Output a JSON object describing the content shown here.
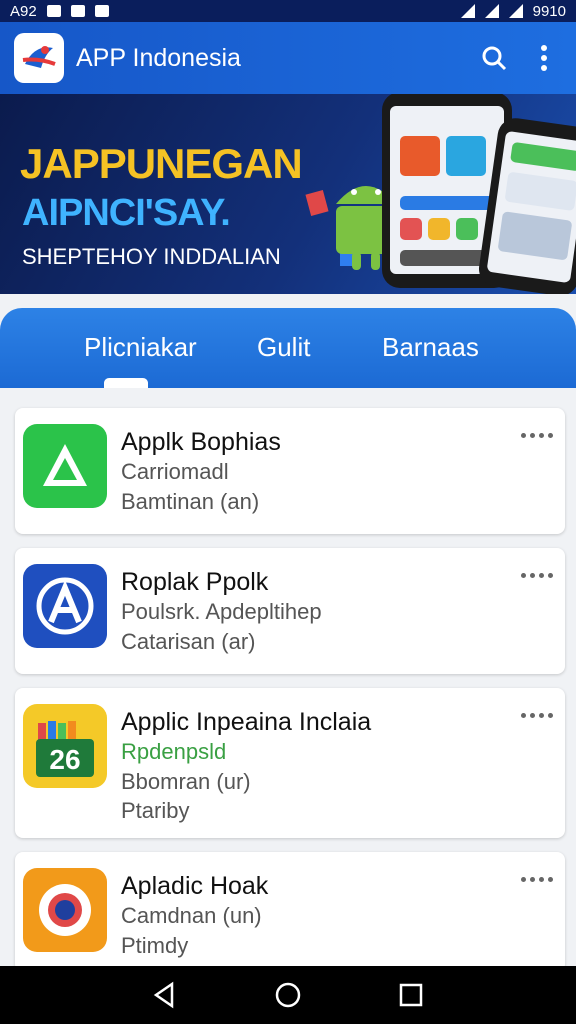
{
  "status_bar": {
    "left_text": "A92",
    "right_text": "9910"
  },
  "app_bar": {
    "title": "APP Indonesia",
    "search_icon": "search-icon",
    "menu_icon": "more-vert-icon"
  },
  "banner": {
    "headline1": "JAPPUNEGAN",
    "headline2": "AIPNCI'SAY.",
    "subtitle": "SHEPTEHOY INDDALIAN"
  },
  "tabs": [
    {
      "label": "Plicniakar"
    },
    {
      "label": "Gulit"
    },
    {
      "label": "Barnaas"
    }
  ],
  "apps": [
    {
      "title": "Applk Bophias",
      "line2": "Carriomadl",
      "line3": "Bamtinan (an)",
      "line4": "",
      "line2_color": "#555555",
      "icon": "green-triangle-app-icon",
      "icon_bg": "#2bc34a"
    },
    {
      "title": "Roplak Ppolk",
      "line2": "Poulsrk. Apdepltihep",
      "line3": "Catarisan (ar)",
      "line4": "",
      "line2_color": "#555555",
      "icon": "a-logo-app-icon",
      "icon_bg": "#1f4fbf"
    },
    {
      "title": "Applic Inpeaina Inclaia",
      "line2": "Rpdenpsld",
      "line3": "Bbomran (ur)",
      "line4": "Ptariby",
      "line2_color": "#3aa043",
      "icon": "calendar-app-icon",
      "icon_bg": "#f4c928",
      "badge": "26"
    },
    {
      "title": "Apladic Hoak",
      "line2": "Camdnan (un)",
      "line3": "Ptimdy",
      "line4": "",
      "line2_color": "#555555",
      "icon": "target-app-icon",
      "icon_bg": "#f29a1a"
    }
  ]
}
